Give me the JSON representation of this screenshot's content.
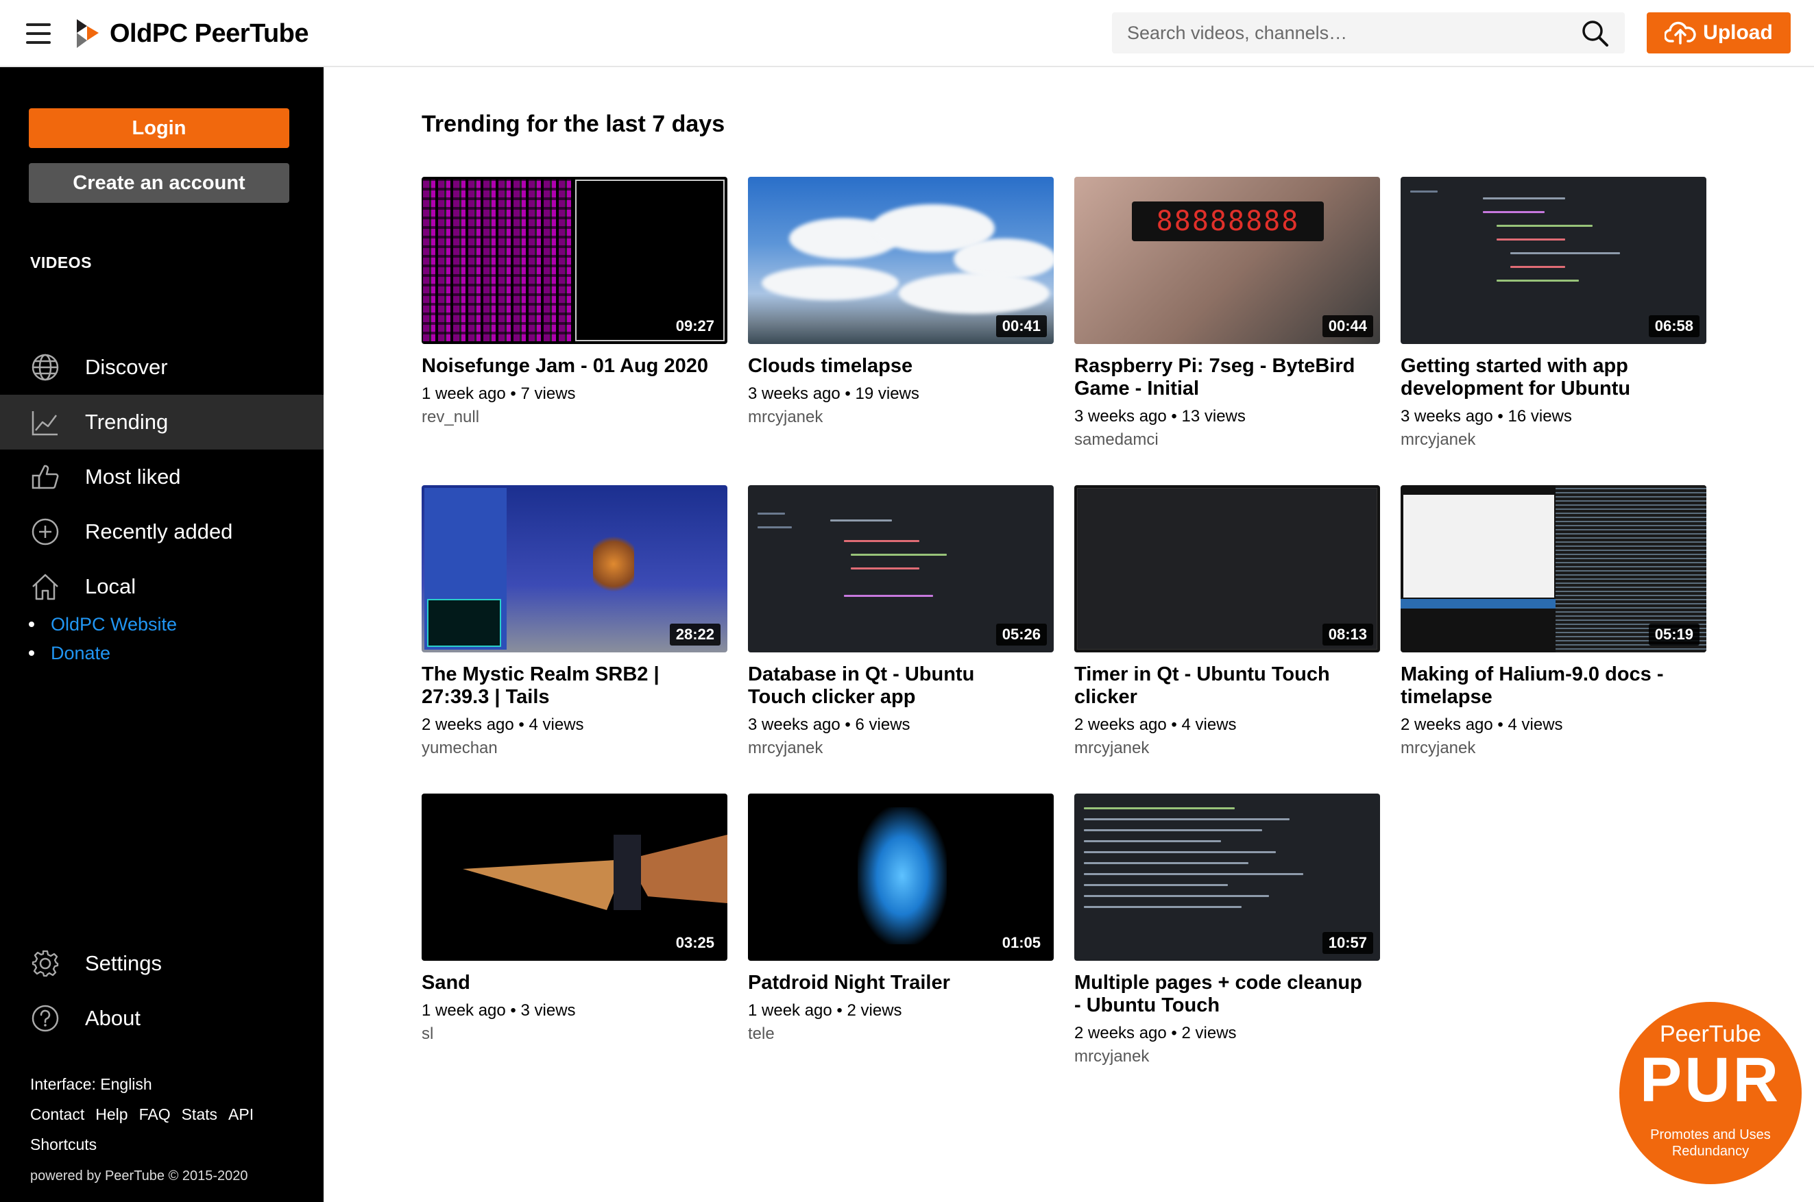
{
  "header": {
    "logo_text": "OldPC PeerTube",
    "search_placeholder": "Search videos, channels…",
    "upload_label": "Upload"
  },
  "sidebar": {
    "login_label": "Login",
    "create_account_label": "Create an account",
    "videos_heading": "VIDEOS",
    "nav": [
      {
        "label": "Discover",
        "icon": "globe-icon"
      },
      {
        "label": "Trending",
        "icon": "trending-icon",
        "active": true
      },
      {
        "label": "Most liked",
        "icon": "thumbs-up-icon"
      },
      {
        "label": "Recently added",
        "icon": "plus-circle-icon"
      },
      {
        "label": "Local",
        "icon": "home-icon"
      }
    ],
    "links": [
      "OldPC Website",
      "Donate"
    ],
    "settings_label": "Settings",
    "about_label": "About",
    "interface_label": "Interface: English",
    "footer_links": [
      "Contact",
      "Help",
      "FAQ",
      "Stats",
      "API"
    ],
    "shortcuts_label": "Shortcuts",
    "powered_by": "powered by PeerTube © 2015-2020"
  },
  "main": {
    "title": "Trending for the last 7 days",
    "videos": [
      {
        "title": "Noisefunge Jam - 01 Aug 2020",
        "duration": "09:27",
        "meta": "1 week ago • 7 views",
        "channel": "rev_null"
      },
      {
        "title": "Clouds timelapse",
        "duration": "00:41",
        "meta": "3 weeks ago • 19 views",
        "channel": "mrcyjanek"
      },
      {
        "title": "Raspberry Pi: 7seg - ByteBird Game - Initial",
        "duration": "00:44",
        "meta": "3 weeks ago • 13 views",
        "channel": "samedamci"
      },
      {
        "title": "Getting started with app development for Ubuntu",
        "duration": "06:58",
        "meta": "3 weeks ago • 16 views",
        "channel": "mrcyjanek"
      },
      {
        "title": "The Mystic Realm SRB2 | 27:39.3 | Tails",
        "duration": "28:22",
        "meta": "2 weeks ago • 4 views",
        "channel": "yumechan"
      },
      {
        "title": "Database in Qt - Ubuntu Touch clicker app",
        "duration": "05:26",
        "meta": "3 weeks ago • 6 views",
        "channel": "mrcyjanek"
      },
      {
        "title": "Timer in Qt - Ubuntu Touch clicker",
        "duration": "08:13",
        "meta": "2 weeks ago • 4 views",
        "channel": "mrcyjanek"
      },
      {
        "title": "Making of Halium-9.0 docs - timelapse",
        "duration": "05:19",
        "meta": "2 weeks ago • 4 views",
        "channel": "mrcyjanek"
      },
      {
        "title": "Sand",
        "duration": "03:25",
        "meta": "1 week ago • 3 views",
        "channel": "sl"
      },
      {
        "title": "Patdroid Night Trailer",
        "duration": "01:05",
        "meta": "1 week ago • 2 views",
        "channel": "tele"
      },
      {
        "title": "Multiple pages + code cleanup - Ubuntu Touch",
        "duration": "10:57",
        "meta": "2 weeks ago • 2 views",
        "channel": "mrcyjanek"
      }
    ]
  },
  "badge": {
    "top": "PeerTube",
    "big": "PUR",
    "small": "Promotes and Uses Redundancy"
  },
  "colors": {
    "accent": "#f1680d",
    "sidebar_bg": "#000000",
    "link": "#2196f3"
  }
}
